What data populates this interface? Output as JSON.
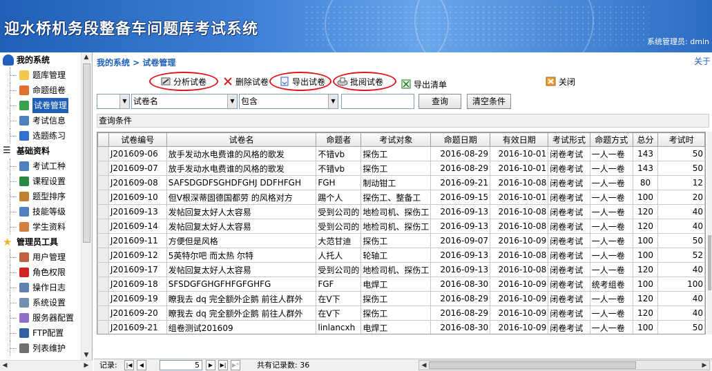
{
  "header": {
    "title": "迎水桥机务段整备车间题库考试系统",
    "user_label": "系统管理员: dmin"
  },
  "sidebar": {
    "groups": [
      {
        "label": "我的系统",
        "icon": "user-group-icon",
        "items": [
          {
            "label": "题库管理",
            "icon": "folder-icon"
          },
          {
            "label": "命题组卷",
            "icon": "pencil-icon"
          },
          {
            "label": "试卷管理",
            "icon": "refresh-doc-icon",
            "active": true
          },
          {
            "label": "考试信息",
            "icon": "search-icon"
          },
          {
            "label": "选题练习",
            "icon": "play-icon"
          }
        ]
      },
      {
        "label": "基础资料",
        "icon": "list-icon",
        "items": [
          {
            "label": "考试工种",
            "icon": "search-icon"
          },
          {
            "label": "课程设置",
            "icon": "book-icon"
          },
          {
            "label": "题型排序",
            "icon": "globe-icon"
          },
          {
            "label": "技能等级",
            "icon": "search-icon"
          },
          {
            "label": "学生资料",
            "icon": "user-icon"
          }
        ]
      },
      {
        "label": "管理员工具",
        "icon": "star-icon",
        "items": [
          {
            "label": "用户管理",
            "icon": "users-icon"
          },
          {
            "label": "角色权限",
            "icon": "stop-icon"
          },
          {
            "label": "操作日志",
            "icon": "log-icon"
          },
          {
            "label": "系统设置",
            "icon": "gear-icon"
          },
          {
            "label": "服务器配置",
            "icon": "server-icon"
          },
          {
            "label": "FTP配置",
            "icon": "ftp-icon"
          },
          {
            "label": "列表维护",
            "icon": "list-doc-icon"
          }
        ]
      }
    ]
  },
  "breadcrumb": "我的系统 > 试卷管理",
  "about": "关于",
  "toolbar": {
    "analyze": "分析试卷",
    "delete": "删除试卷",
    "export": "导出试卷",
    "review": "批阅试卷",
    "export_list": "导出清单",
    "close": "关闭"
  },
  "filter": {
    "field1_value": "",
    "field2_value": "试卷名",
    "operator_value": "包含",
    "keyword_value": "",
    "search_label": "查询",
    "clear_label": "清空条件"
  },
  "query_bar_label": "查询条件",
  "table": {
    "columns": [
      "试卷编号",
      "试卷名",
      "命题者",
      "考试对象",
      "命题日期",
      "有效日期",
      "考试形式",
      "命题方式",
      "总分",
      "考试时"
    ],
    "rows": [
      [
        "J201609-06",
        "放手发动水电费谁的风格的歌发",
        "不错vb",
        "探伤工",
        "2016-08-29",
        "2016-10-01",
        "闭卷考试",
        "一人一卷",
        "143",
        "50"
      ],
      [
        "J201609-07",
        "放手发动水电费谁的风格的歌发",
        "不错vb",
        "探伤工",
        "2016-08-29",
        "2016-10-01",
        "闭卷考试",
        "一人一卷",
        "143",
        "50"
      ],
      [
        "J201609-08",
        "SAFSDGDFSGHDFGHJ DDFHFGH",
        "FGH",
        "制动钳工",
        "2016-09-21",
        "2016-10-08",
        "闭卷考试",
        "一人一卷",
        "80",
        "12"
      ],
      [
        "J201609-10",
        "但V根深蒂固德国都劳   的风格对方",
        "踢个人",
        "探伤工、整备工",
        "2016-09-15",
        "2016-10-01",
        "闭卷考试",
        "一人一卷",
        "100",
        "20"
      ],
      [
        "J201609-13",
        "发帖回复太好人太容易",
        "受到公司的",
        "地检司机、探伤工",
        "2016-09-13",
        "2016-10-08",
        "闭卷考试",
        "一人一卷",
        "120",
        "40"
      ],
      [
        "J201609-14",
        "发帖回复太好人太容易",
        "受到公司的",
        "地检司机、探伤工",
        "2016-09-13",
        "2016-10-08",
        "闭卷考试",
        "一人一卷",
        "120",
        "40"
      ],
      [
        "J201609-11",
        "方便但是风格",
        "大范甘迪",
        "探伤工",
        "2016-09-07",
        "2016-10-09",
        "闭卷考试",
        "一人一卷",
        "100",
        "50"
      ],
      [
        "J201609-12",
        "5英特尔吧 而太热    尔特",
        "人托人",
        "轮轴工",
        "2016-09-13",
        "2016-10-08",
        "闭卷考试",
        "一人一卷",
        "100",
        "52"
      ],
      [
        "J201609-17",
        "发帖回复太好人太容易",
        "受到公司的",
        "地检司机、探伤工",
        "2016-09-13",
        "2016-10-08",
        "闭卷考试",
        "一人一卷",
        "120",
        "40"
      ],
      [
        "J201609-18",
        "SFSDGFGHGFHFGFGHFG",
        "FGF",
        "电焊工",
        "2016-08-30",
        "2016-10-09",
        "闭卷考试",
        "统考组卷",
        "100",
        "100"
      ],
      [
        "J201609-19",
        "瞭我去 dq   完全额外企鹅 前往人群外",
        "在V下",
        "探伤工",
        "2016-08-29",
        "2016-10-09",
        "闭卷考试",
        "一人一卷",
        "120",
        "40"
      ],
      [
        "J201609-20",
        "瞭我去 dq   完全额外企鹅 前往人群外",
        "在V下",
        "探伤工",
        "2016-08-29",
        "2016-10-09",
        "闭卷考试",
        "一人一卷",
        "120",
        "40"
      ],
      [
        "J201609-21",
        "组卷测试201609",
        "linlancxh",
        "电焊工",
        "2016-08-30",
        "2016-10-09",
        "闭卷考试",
        "一人一卷",
        "100",
        "50"
      ]
    ]
  },
  "status": {
    "record_label": "记录:",
    "record_value": "5",
    "total_label": "共有记录数: 36"
  }
}
